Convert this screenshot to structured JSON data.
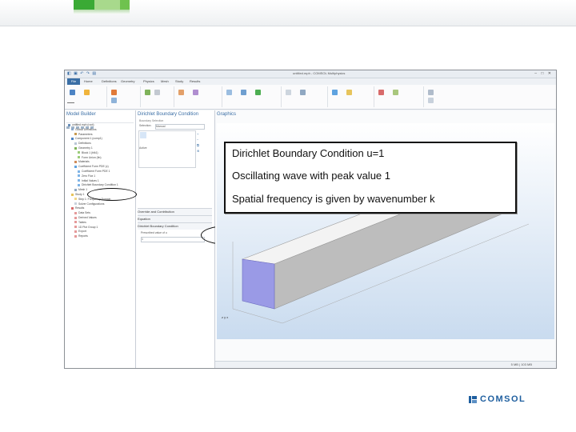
{
  "window": {
    "title": "untitled.mph - COMSOL Multiphysics"
  },
  "menu_tabs": [
    "File",
    "Home",
    "Definitions",
    "Geometry",
    "Physics",
    "Mesh",
    "Study",
    "Results"
  ],
  "panels": {
    "model_builder": {
      "title": "Model Builder"
    },
    "settings": {
      "title": "Dirichlet Boundary Condition",
      "sections": [
        "Boundary Selection",
        "Override and Contribution",
        "Equation",
        "Dirichlet Boundary Condition",
        "Prescribed value of u"
      ],
      "selection_label": "Selection:",
      "selection_value": "Manual",
      "active_label": "Active",
      "value_field": "1"
    },
    "graphics": {
      "title": "Graphics",
      "status": "5 MB | 103 MB"
    }
  },
  "tree": [
    "untitled.mph (root)",
    "Global Definitions",
    "Parameters",
    "Component 1 (comp1)",
    "Definitions",
    "Geometry 1",
    "Block 1 (blk1)",
    "Form Union (fin)",
    "Materials",
    "Coefficient Form PDE (c)",
    "Coefficient Form PDE 1",
    "Zero Flux 1",
    "Initial Values 1",
    "Dirichlet Boundary Condition 1",
    "Mesh 1",
    "Study 1",
    "Step 1: Frequency Domain",
    "Solver Configurations",
    "Results",
    "Data Sets",
    "Derived Values",
    "Tables",
    "1D Plot Group 1",
    "Export",
    "Reports"
  ],
  "callout": {
    "line1": "Dirichlet Boundary Condition u=1",
    "line2": "Oscillating wave with peak value 1",
    "line3": "Spatial frequency is given by wavenumber k"
  },
  "brand": {
    "name": "COMSOL",
    "color": "#1f5f9f",
    "accent": "#3aaa35"
  },
  "axes_labels": {
    "x": "x",
    "y": "y",
    "z": "z"
  }
}
